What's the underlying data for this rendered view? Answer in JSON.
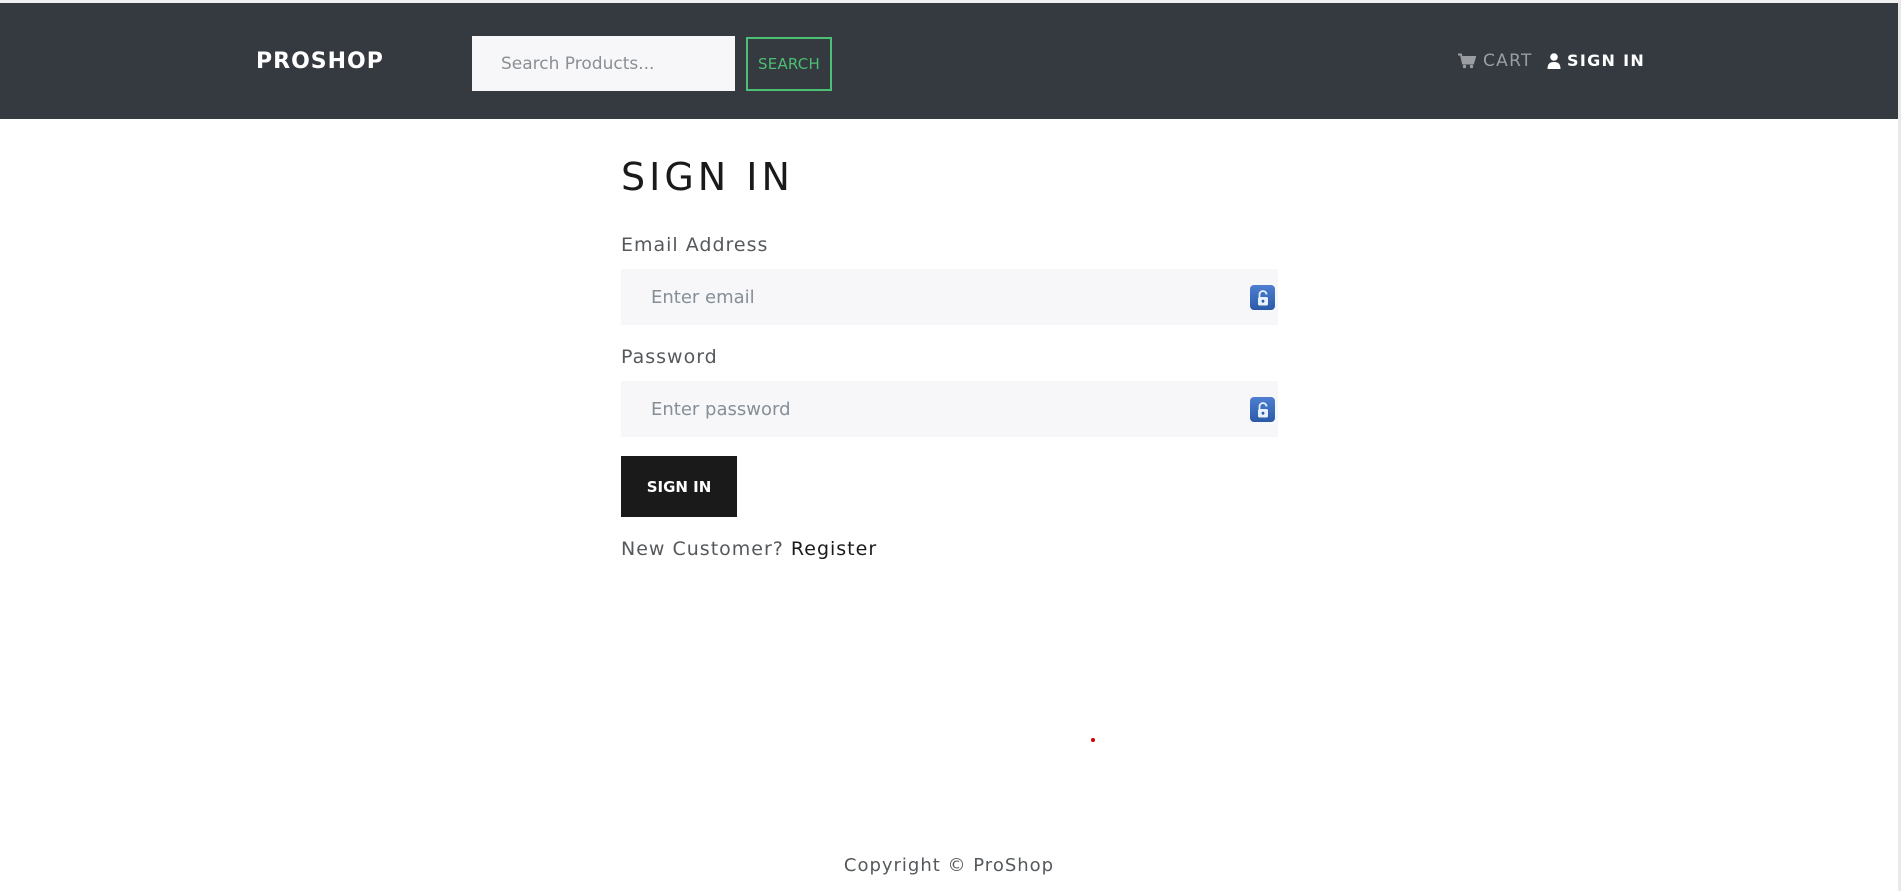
{
  "header": {
    "brand": "PROSHOP",
    "search_placeholder": "Search Products...",
    "search_button": "SEARCH",
    "cart_label": "CART",
    "signin_label": "SIGN IN",
    "cart_icon": "cart-icon",
    "user_icon": "user-icon"
  },
  "form": {
    "title": "SIGN IN",
    "email_label": "Email Address",
    "email_placeholder": "Enter email",
    "email_value": "",
    "password_label": "Password",
    "password_placeholder": "Enter password",
    "password_value": "",
    "submit_label": "SIGN IN",
    "new_customer_text": "New Customer?",
    "register_link": "Register",
    "field_icon": "password-manager-lock-icon"
  },
  "footer": {
    "copyright": "Copyright © ProShop"
  },
  "colors": {
    "navbar": "#343a40",
    "accent": "#4bbf73",
    "button_dark": "#1a1a1a",
    "field_bg": "#f7f7f9"
  }
}
